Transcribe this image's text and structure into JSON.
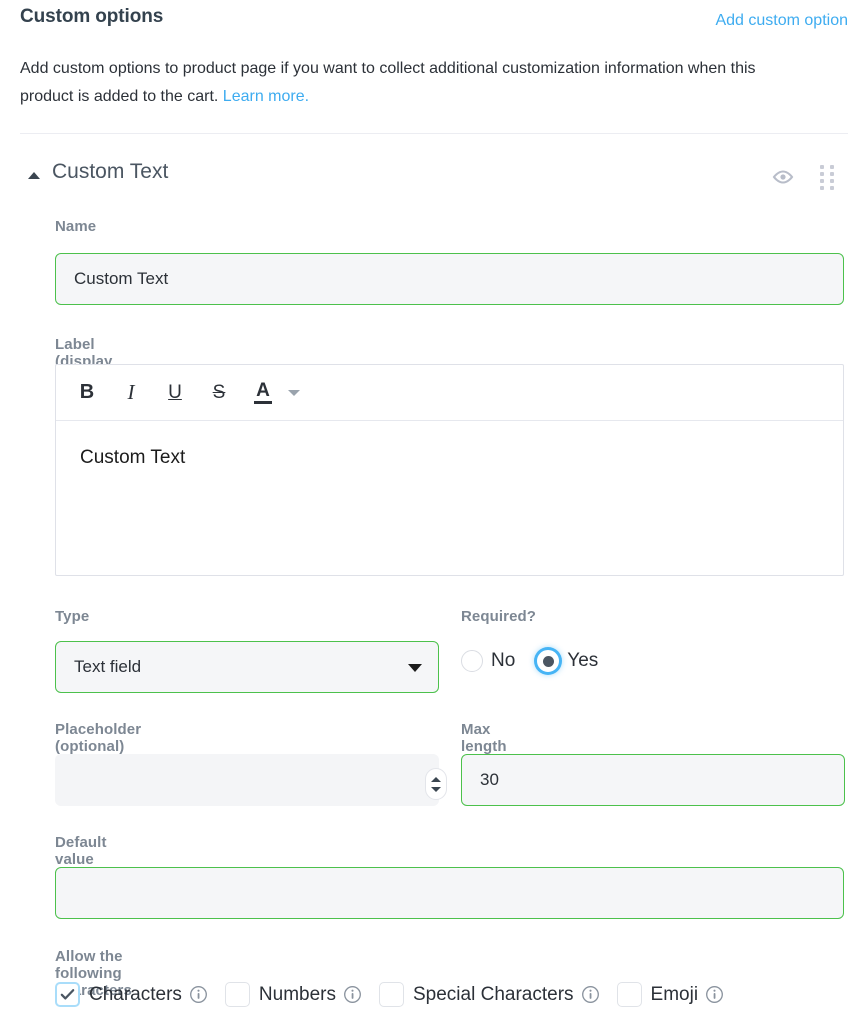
{
  "header": {
    "title": "Custom options",
    "add_link": "Add custom option",
    "description_part1": "Add custom options to product page if you want to collect additional customization information when this product is added to the cart.",
    "learn_more": "Learn more."
  },
  "section": {
    "title": "Custom Text",
    "collapse_icon": "caret-up-icon",
    "visibility_icon": "eye-icon",
    "drag_icon": "drag-handle-icon"
  },
  "fields": {
    "name": {
      "label": "Name",
      "value": "Custom Text",
      "placeholder": ""
    },
    "storefront_label": {
      "label": "Label (display on storefront)",
      "content": "Custom Text",
      "toolbar": [
        {
          "name": "bold-button",
          "glyph": "B"
        },
        {
          "name": "italic-button",
          "glyph": "I"
        },
        {
          "name": "underline-button",
          "glyph": "U"
        },
        {
          "name": "strikethrough-button",
          "glyph": "S"
        },
        {
          "name": "text-color-button",
          "glyph": "A"
        }
      ],
      "toolbar_more_icon": "chevron-down-icon"
    },
    "type": {
      "label": "Type",
      "value": "Text field",
      "caret_icon": "caret-down-icon"
    },
    "required": {
      "label": "Required?",
      "options": [
        {
          "label": "No",
          "selected": false
        },
        {
          "label": "Yes",
          "selected": true
        }
      ]
    },
    "placeholder_field": {
      "label": "Placeholder (optional)",
      "value": "",
      "placeholder": ""
    },
    "max_length": {
      "label": "Max length",
      "value": "30",
      "spinner_up_icon": "chevron-up-icon",
      "spinner_down_icon": "chevron-down-icon"
    },
    "default_value": {
      "label": "Default value (prefill on storefront)",
      "value": "",
      "placeholder": ""
    },
    "allow_characters": {
      "label": "Allow the following characters",
      "options": [
        {
          "label": "Characters",
          "checked": true,
          "info_icon": "info-icon"
        },
        {
          "label": "Numbers",
          "checked": false,
          "info_icon": "info-icon"
        },
        {
          "label": "Special Characters",
          "checked": false,
          "info_icon": "info-icon"
        },
        {
          "label": "Emoji",
          "checked": false,
          "info_icon": "info-icon"
        }
      ]
    }
  },
  "colors": {
    "link": "#3eacf0",
    "input_border_valid": "#4cc14c",
    "radio_accent": "#46b4f5",
    "checkbox_accent": "#a9ddfa",
    "label_text": "#7d8793",
    "heading_text": "#34424e"
  }
}
